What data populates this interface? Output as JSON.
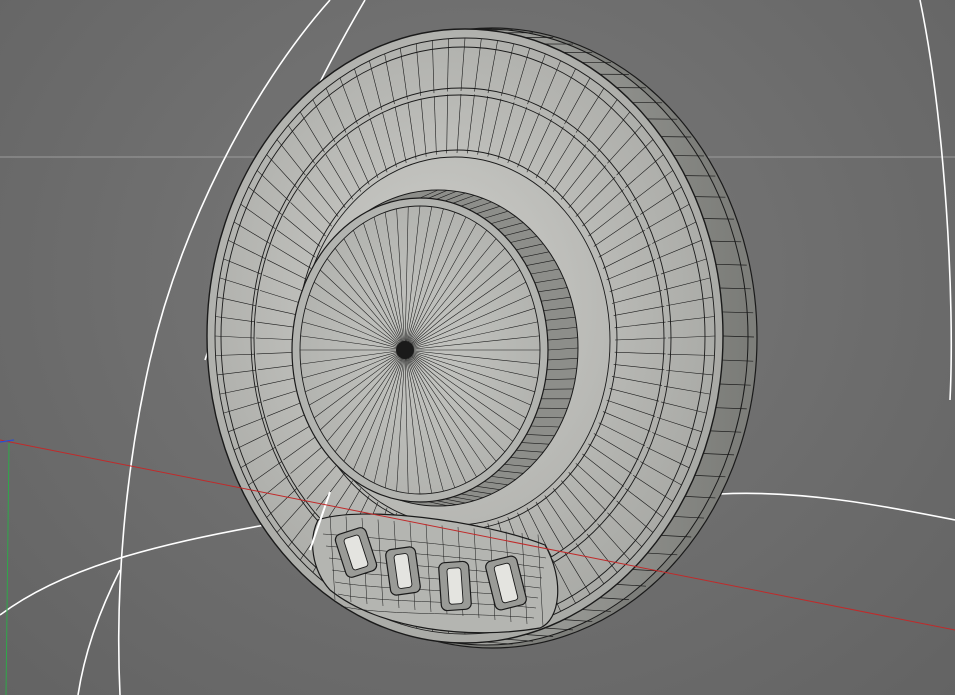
{
  "scene": {
    "object": "wireframe-knob",
    "view": "perspective-3d-viewport",
    "colors": {
      "background": "#707070",
      "wire": "#1a1a1a",
      "surface_light": "#d8d8d4",
      "surface_mid": "#a9aaa6",
      "surface_dark": "#7d7e7a",
      "x_axis": "#c02a2a",
      "y_axis": "#2fa84a",
      "z_axis": "#2a4fd0",
      "guide_curve": "#ffffff",
      "horizon": "#9a9a9a"
    },
    "knob": {
      "outer_segments": 96,
      "inner_segments": 64,
      "button_count": 4
    }
  }
}
